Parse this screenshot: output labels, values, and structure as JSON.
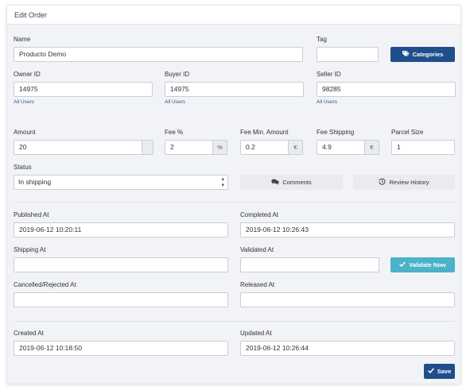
{
  "panel": {
    "title": "Edit Order"
  },
  "fields": {
    "name": {
      "label": "Name",
      "value": "Producto Demo"
    },
    "tag": {
      "label": "Tag",
      "value": ""
    },
    "owner_id": {
      "label": "Owner ID",
      "value": "14975",
      "link": "All Users"
    },
    "buyer_id": {
      "label": "Buyer ID",
      "value": "14975",
      "link": "All Users"
    },
    "seller_id": {
      "label": "Seller ID",
      "value": "98285",
      "link": "All Users"
    },
    "amount": {
      "label": "Amount",
      "value": "20",
      "addon": ""
    },
    "fee_pct": {
      "label": "Fee %",
      "value": "2",
      "addon": "%"
    },
    "fee_min": {
      "label": "Fee Min. Amount",
      "value": "0.2",
      "addon": "€"
    },
    "fee_shipping": {
      "label": "Fee Shipping",
      "value": "4.9",
      "addon": "€"
    },
    "parcel_size": {
      "label": "Parcel Size",
      "value": "1"
    },
    "status": {
      "label": "Status",
      "value": "In shipping"
    },
    "published_at": {
      "label": "Published At",
      "value": "2019-06-12 10:20:11"
    },
    "completed_at": {
      "label": "Completed At",
      "value": "2019-06-12 10:26:43"
    },
    "shipping_at": {
      "label": "Shipping At",
      "value": ""
    },
    "validated_at": {
      "label": "Validated At",
      "value": ""
    },
    "cancelled_at": {
      "label": "Cancelled/Rejected At",
      "value": ""
    },
    "released_at": {
      "label": "Released At",
      "value": ""
    },
    "created_at": {
      "label": "Created At",
      "value": "2019-06-12 10:18:50"
    },
    "updated_at": {
      "label": "Updated At",
      "value": "2019-06-12 10:26:44"
    }
  },
  "buttons": {
    "categories": {
      "label": "Categories",
      "icon": "tags-icon"
    },
    "comments": {
      "label": "Comments",
      "icon": "comments-icon"
    },
    "review_history": {
      "label": "Review History",
      "icon": "history-icon"
    },
    "validate_now": {
      "label": "Validate Now",
      "icon": "check-icon"
    },
    "save": {
      "label": "Save",
      "icon": "check-icon"
    }
  },
  "colors": {
    "primary": "#1f4e8c",
    "teal": "#4cb2c7",
    "panel_bg": "#f1f3f6",
    "link": "#2b5a8a"
  }
}
